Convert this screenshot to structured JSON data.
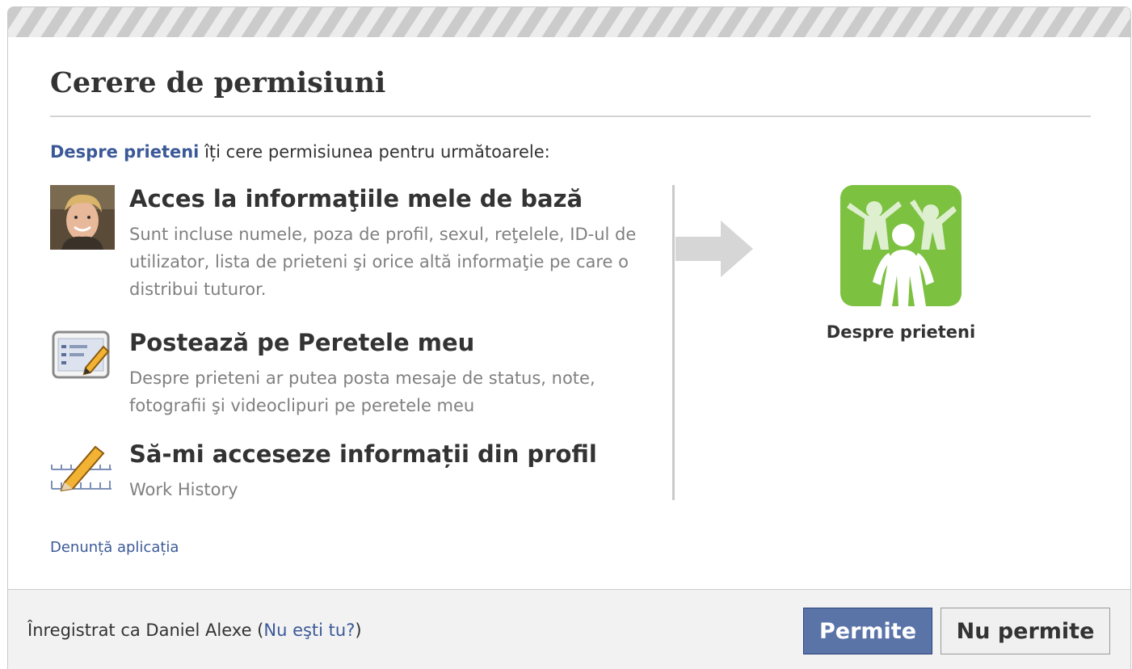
{
  "dialog": {
    "title": "Cerere de permisiuni",
    "intro_app": "Despre prieteni",
    "intro_text": " îți cere permisiunea pentru următoarele:",
    "permissions": [
      {
        "icon": "profile-photo-icon",
        "title": "Acces la informaţiile mele de bază",
        "description": "Sunt incluse numele, poza de profil, sexul, reţelele, ID-ul de utilizator, lista de prieteni şi orice altă informaţie pe care o distribui tuturor."
      },
      {
        "icon": "wall-post-icon",
        "title": "Postează pe Peretele meu",
        "description": "Despre prieteni ar putea posta mesaje de status, note, fotografii şi videoclipuri pe peretele meu"
      },
      {
        "icon": "pencil-ruler-icon",
        "title": "Să-mi acceseze informații din profil",
        "description": "Work History"
      }
    ],
    "app_name": "Despre prieteni",
    "report_link": "Denunță aplicația",
    "footer": {
      "logged_in_prefix": "Înregistrat ca Daniel Alexe (",
      "not_you_link": "Nu eşti tu?",
      "logged_in_suffix": ")",
      "allow_label": "Permite",
      "deny_label": "Nu permite"
    }
  },
  "colors": {
    "link": "#3b5998",
    "allow_button": "#5b74a8",
    "app_icon_green": "#7cc140"
  }
}
